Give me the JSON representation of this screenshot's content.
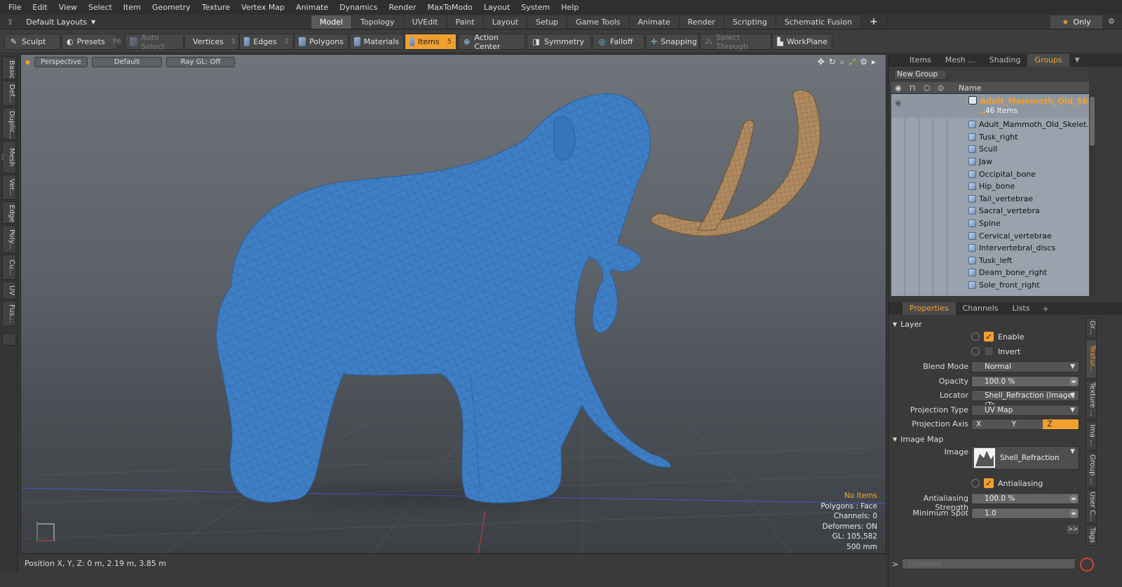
{
  "menu": [
    "File",
    "Edit",
    "View",
    "Select",
    "Item",
    "Geometry",
    "Texture",
    "Vertex Map",
    "Animate",
    "Dynamics",
    "Render",
    "MaxToModo",
    "Layout",
    "System",
    "Help"
  ],
  "layout": {
    "label": "Default Layouts"
  },
  "tabs": [
    "Model",
    "Topology",
    "UVEdit",
    "Paint",
    "Layout",
    "Setup",
    "Game Tools",
    "Animate",
    "Render",
    "Scripting",
    "Schematic Fusion"
  ],
  "only_label": "Only",
  "toolbar": {
    "sculpt": "Sculpt",
    "presets": "Presets",
    "presets_key": "F6",
    "auto_select": "Auto Select",
    "vertices": "Vertices",
    "vertices_key": "1",
    "edges": "Edges",
    "edges_key": "2",
    "polygons": "Polygons",
    "materials": "Materials",
    "items": "Items",
    "items_key": "5",
    "action_center": "Action Center",
    "symmetry": "Symmetry",
    "falloff": "Falloff",
    "snapping": "Snapping",
    "select_through": "Select Through",
    "workplane": "WorkPlane"
  },
  "left_tabs": [
    "Basic",
    "Def...",
    "Duplic...",
    "Mesh ...",
    "Ver...",
    "Edge",
    "Poly...",
    "Cu...",
    "UV",
    "Fus..."
  ],
  "viewport": {
    "view": "Perspective",
    "shading": "Default",
    "raygl": "Ray GL: Off",
    "hud": {
      "no_items": "No Items",
      "polygons": "Polygons : Face",
      "channels": "Channels: 0",
      "deformers": "Deformers: ON",
      "gl": "GL: 105,582",
      "scale": "500 mm"
    }
  },
  "status": {
    "position": "Position X, Y, Z:   0 m, 2.19 m, 3.85 m"
  },
  "groups_tabs": [
    "Items",
    "Mesh ...",
    "Shading",
    "Groups"
  ],
  "groups": {
    "new_group": "New Group",
    "name_header": "Name",
    "group_name": "Adult_Mammoth_Old_Sk ...",
    "group_count": "46 Items",
    "items": [
      "Adult_Mammoth_Old_Skelet...",
      "Tusk_right",
      "Scull",
      "Jaw",
      "Occipital_bone",
      "Hip_bone",
      "Tail_vertebrae",
      "Sacral_vertebra",
      "Spine",
      "Cervical_vertebrae",
      "Intervertebral_discs",
      "Tusk_left",
      "Deam_bone_right",
      "Sole_front_right"
    ]
  },
  "props_tabs": [
    "Properties",
    "Channels",
    "Lists"
  ],
  "props": {
    "layer": "Layer",
    "enable": "Enable",
    "invert": "Invert",
    "blend_mode_label": "Blend Mode",
    "blend_mode": "Normal",
    "opacity_label": "Opacity",
    "opacity": "100.0 %",
    "locator_label": "Locator",
    "locator": "Shell_Refraction (Image) (Te ...",
    "projection_type_label": "Projection Type",
    "projection_type": "UV Map",
    "projection_axis_label": "Projection Axis",
    "axis_x": "X",
    "axis_y": "Y",
    "axis_z": "Z",
    "image_map": "Image Map",
    "image_label": "Image",
    "image": "Shell_Refraction",
    "antialiasing": "Antialiasing",
    "aa_strength_label": "Antialiasing Strength",
    "aa_strength": "100.0 %",
    "min_spot_label": "Minimum Spot",
    "min_spot": "1.0",
    "more": ">>"
  },
  "right_vtabs": [
    "Gr...",
    "Textur...",
    "Texture ...",
    "Ima ...",
    "Group ...",
    "User C...",
    "Tags"
  ],
  "command_placeholder": "Command",
  "colors": {
    "accent": "#f0a030",
    "mesh": "#3f7fc6",
    "tusk": "#b08a60"
  }
}
